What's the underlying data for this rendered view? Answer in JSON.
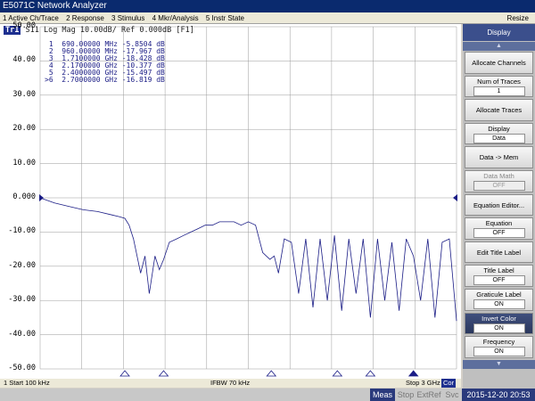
{
  "window": {
    "title": "E5071C Network Analyzer"
  },
  "menu": {
    "items": [
      "1 Active Ch/Trace",
      "2 Response",
      "3 Stimulus",
      "4 Mkr/Analysis",
      "5 Instr State"
    ],
    "resize": "Resize"
  },
  "trace": {
    "badge": "Tr1",
    "title": "S11 Log Mag 10.00dB/ Ref 0.000dB [F1]"
  },
  "markers": [
    {
      "id": "1",
      "freq": "690.00000 MHz",
      "value": "-5.8504 dB"
    },
    {
      "id": "2",
      "freq": "960.00000 MHz",
      "value": "-17.967 dB"
    },
    {
      "id": "3",
      "freq": "1.7100000 GHz",
      "value": "-18.428 dB"
    },
    {
      "id": "4",
      "freq": "2.1700000 GHz",
      "value": "-10.377 dB"
    },
    {
      "id": "5",
      "freq": "2.4000000 GHz",
      "value": "-15.497 dB"
    },
    {
      "id": ">6",
      "freq": "2.7000000 GHz",
      "value": "-16.819 dB"
    }
  ],
  "chart_data": {
    "type": "line",
    "y_tick_labels": [
      "50.00",
      "40.00",
      "30.00",
      "20.00",
      "10.00",
      "0.000",
      "-10.00",
      "-20.00",
      "-30.00",
      "-40.00",
      "-50.00"
    ],
    "ylim": [
      -50,
      50
    ],
    "xlim_ghz": [
      0.1,
      3.0
    ],
    "series": [
      {
        "x_ghz": [
          0.1,
          0.2,
          0.3,
          0.4,
          0.5,
          0.6,
          0.65,
          0.69,
          0.72,
          0.75,
          0.78,
          0.8,
          0.83,
          0.86,
          0.9,
          0.93,
          0.96,
          1.0,
          1.05,
          1.1,
          1.15,
          1.2,
          1.25,
          1.3,
          1.35,
          1.4,
          1.45,
          1.5,
          1.55,
          1.6,
          1.65,
          1.7,
          1.73,
          1.76,
          1.8,
          1.85,
          1.9,
          1.95,
          2.0,
          2.05,
          2.1,
          2.15,
          2.2,
          2.25,
          2.3,
          2.35,
          2.4,
          2.45,
          2.5,
          2.55,
          2.6,
          2.65,
          2.7,
          2.75,
          2.8,
          2.85,
          2.9,
          2.95,
          3.0
        ],
        "y_db": [
          0,
          -1.5,
          -2.5,
          -3.5,
          -4,
          -5,
          -5.5,
          -6,
          -8,
          -12,
          -18,
          -22,
          -17,
          -28,
          -17,
          -21,
          -18,
          -13,
          -12,
          -11,
          -10,
          -9,
          -8,
          -8,
          -7,
          -7,
          -7,
          -8,
          -7,
          -8,
          -16,
          -18,
          -17,
          -22,
          -12,
          -13,
          -28,
          -12,
          -32,
          -12,
          -30,
          -11,
          -33,
          -12,
          -28,
          -12,
          -35,
          -12,
          -30,
          -13,
          -33,
          -12,
          -17,
          -30,
          -12,
          -35,
          -13,
          -12,
          -36
        ]
      }
    ]
  },
  "status": {
    "start": "1  Start 100 kHz",
    "ifbw": "IFBW 70 kHz",
    "stop": "Stop 3 GHz",
    "cor": "Cor"
  },
  "bottom": {
    "meas": "Meas",
    "stop": "Stop",
    "extref": "ExtRef",
    "svc": "Svc",
    "datetime": "2015-12-20 20:53"
  },
  "softkeys": {
    "header": "Display",
    "items": [
      {
        "label": "Allocate Channels",
        "value": ""
      },
      {
        "label": "Num of Traces",
        "value": "1"
      },
      {
        "label": "Allocate Traces",
        "value": ""
      },
      {
        "label": "Display",
        "value": "Data"
      },
      {
        "label": "Data -> Mem",
        "value": ""
      },
      {
        "label": "Data Math",
        "value": "OFF"
      },
      {
        "label": "Equation Editor...",
        "value": ""
      },
      {
        "label": "Equation",
        "value": "OFF"
      },
      {
        "label": "Edit Title Label",
        "value": ""
      },
      {
        "label": "Title Label",
        "value": "OFF"
      },
      {
        "label": "Graticule Label",
        "value": "ON"
      },
      {
        "label": "Invert Color",
        "value": "ON"
      },
      {
        "label": "Frequency",
        "value": "ON"
      }
    ]
  },
  "colors": {
    "trace": "#1b1d86",
    "grid": "#9a9a9a",
    "softkey_header": "#3b4f8c"
  }
}
